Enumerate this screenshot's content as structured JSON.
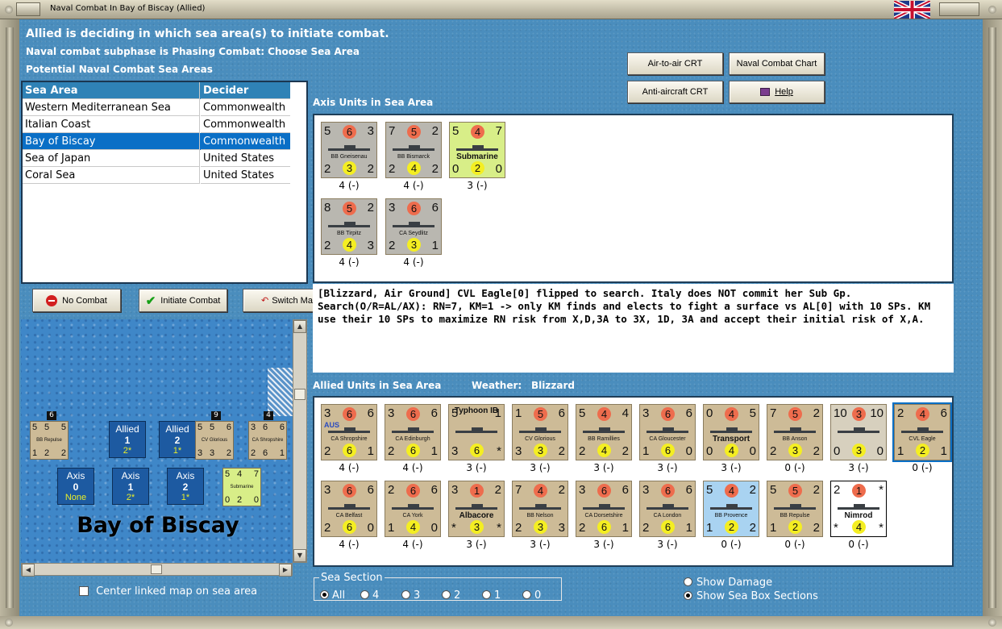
{
  "window": {
    "title": "Naval Combat In Bay of Biscay (Allied)",
    "flag_icon": "union-jack-icon"
  },
  "header": {
    "line1": "Allied is deciding in which sea area(s) to initiate combat.",
    "line2": "Naval combat subphase is Phasing Combat: Choose Sea Area",
    "line3": "Potential Naval Combat Sea Areas"
  },
  "buttons": {
    "air_to_air": "Air-to-air CRT",
    "naval_chart": "Naval Combat Chart",
    "anti_aircraft": "Anti-aircraft CRT",
    "help": "Help",
    "no_combat": "No Combat",
    "initiate": "Initiate Combat",
    "switch": "Switch Ma"
  },
  "sea_table": {
    "headers": [
      "Sea Area",
      "Decider"
    ],
    "rows": [
      [
        "Western Mediterranean Sea",
        "Commonwealth"
      ],
      [
        "Italian Coast",
        "Commonwealth"
      ],
      [
        "Bay of Biscay",
        "Commonwealth"
      ],
      [
        "Sea of Japan",
        "United States"
      ],
      [
        "Coral Sea",
        "United States"
      ]
    ],
    "selected_index": 2
  },
  "axis": {
    "title": "Axis Units in Sea Area",
    "units": [
      {
        "name": "BB Gneisenau",
        "tl": "5",
        "tc": "6",
        "tr": "3",
        "bl": "2",
        "bc": "3",
        "br": "2",
        "stat": "4 (-)",
        "color": "gray"
      },
      {
        "name": "BB Bismarck",
        "tl": "7",
        "tc": "5",
        "tr": "2",
        "bl": "2",
        "bc": "4",
        "br": "2",
        "stat": "4 (-)",
        "color": "gray"
      },
      {
        "name": "Submarine",
        "tl": "5",
        "tc": "4",
        "tr": "7",
        "bl": "0",
        "bc": "2",
        "br": "0",
        "stat": "3 (-)",
        "color": "green"
      },
      {
        "name": "BB Tirpitz",
        "tl": "8",
        "tc": "5",
        "tr": "2",
        "bl": "2",
        "bc": "4",
        "br": "3",
        "stat": "4 (-)",
        "color": "gray"
      },
      {
        "name": "CA Seydlitz",
        "tl": "3",
        "tc": "6",
        "tr": "6",
        "bl": "2",
        "bc": "3",
        "br": "1",
        "stat": "4 (-)",
        "color": "gray"
      }
    ]
  },
  "log_text": "[Blizzard, Air Ground]  CVL Eagle[0] flipped to search.  Italy does NOT commit her Sub Gp.  Search(O/R=AL/AX): RN=7, KM=1 -> only KM finds and elects to fight a surface vs AL[0] with 10 SPs.  KM use their 10 SPs to maximize RN risk from X,D,3A to 3X, 1D, 3A and accept their initial risk of X,A.",
  "allied": {
    "title": "Allied Units in Sea Area",
    "weather_label": "Weather:",
    "weather": "Blizzard",
    "units": [
      {
        "name": "CA Shropshire",
        "tl": "3",
        "tc": "6",
        "tr": "6",
        "bl": "2",
        "bc": "6",
        "br": "1",
        "stat": "4 (-)",
        "color": "tan",
        "flag": "AUS"
      },
      {
        "name": "CA Edinburgh",
        "tl": "3",
        "tc": "6",
        "tr": "6",
        "bl": "2",
        "bc": "6",
        "br": "1",
        "stat": "4 (-)",
        "color": "tan"
      },
      {
        "name": "Typhoon IB",
        "tl": "5",
        "tc": "",
        "tr": "1",
        "bl": "3",
        "bc": "6",
        "br": "*",
        "stat": "3 (-)",
        "color": "tan"
      },
      {
        "name": "CV Glorious",
        "tl": "1",
        "tc": "5",
        "tr": "6",
        "bl": "3",
        "bc": "3",
        "br": "2",
        "stat": "3 (-)",
        "color": "tan"
      },
      {
        "name": "BB Ramillies",
        "tl": "5",
        "tc": "4",
        "tr": "4",
        "bl": "2",
        "bc": "4",
        "br": "2",
        "stat": "3 (-)",
        "color": "tan"
      },
      {
        "name": "CA Gloucester",
        "tl": "3",
        "tc": "6",
        "tr": "6",
        "bl": "1",
        "bc": "6",
        "br": "0",
        "stat": "3 (-)",
        "color": "tan"
      },
      {
        "name": "Transport",
        "tl": "0",
        "tc": "4",
        "tr": "5",
        "bl": "0",
        "bc": "4",
        "br": "0",
        "stat": "3 (-)",
        "color": "tan"
      },
      {
        "name": "BB Anson",
        "tl": "7",
        "tc": "5",
        "tr": "2",
        "bl": "2",
        "bc": "3",
        "br": "2",
        "stat": "0 (-)",
        "color": "tan"
      },
      {
        "name": "",
        "tl": "10",
        "tc": "3",
        "tr": "10",
        "bl": "0",
        "bc": "3",
        "br": "0",
        "stat": "3 (-)",
        "color": "dark"
      },
      {
        "name": "CVL Eagle",
        "tl": "2",
        "tc": "4",
        "tr": "6",
        "bl": "1",
        "bc": "2",
        "br": "1",
        "stat": "0 (-)",
        "color": "tan",
        "selected": true
      },
      {
        "name": "CA Belfast",
        "tl": "3",
        "tc": "6",
        "tr": "6",
        "bl": "2",
        "bc": "6",
        "br": "0",
        "stat": "4 (-)",
        "color": "tan"
      },
      {
        "name": "CA York",
        "tl": "2",
        "tc": "6",
        "tr": "6",
        "bl": "1",
        "bc": "4",
        "br": "0",
        "stat": "4 (-)",
        "color": "tan"
      },
      {
        "name": "Albacore",
        "tl": "3",
        "tc": "1",
        "tr": "2",
        "bl": "*",
        "bc": "3",
        "br": "*",
        "stat": "3 (-)",
        "color": "tan"
      },
      {
        "name": "BB Nelson",
        "tl": "7",
        "tc": "4",
        "tr": "2",
        "bl": "2",
        "bc": "3",
        "br": "3",
        "stat": "3 (-)",
        "color": "tan"
      },
      {
        "name": "CA Dorsetshire",
        "tl": "3",
        "tc": "6",
        "tr": "6",
        "bl": "2",
        "bc": "6",
        "br": "1",
        "stat": "3 (-)",
        "color": "tan"
      },
      {
        "name": "CA London",
        "tl": "3",
        "tc": "6",
        "tr": "6",
        "bl": "2",
        "bc": "6",
        "br": "1",
        "stat": "3 (-)",
        "color": "tan"
      },
      {
        "name": "BB Provence",
        "tl": "5",
        "tc": "4",
        "tr": "2",
        "bl": "1",
        "bc": "2",
        "br": "2",
        "stat": "0 (-)",
        "color": "blue"
      },
      {
        "name": "BB Repulse",
        "tl": "5",
        "tc": "5",
        "tr": "2",
        "bl": "1",
        "bc": "2",
        "br": "2",
        "stat": "0 (-)",
        "color": "tan"
      },
      {
        "name": "Nimrod",
        "tl": "2",
        "tc": "1",
        "tr": "*",
        "bl": "*",
        "bc": "4",
        "br": "*",
        "stat": "0 (-)",
        "color": "white"
      }
    ]
  },
  "map": {
    "title": "Bay of Biscay",
    "allied_boxes": [
      {
        "a": "Allied",
        "b": "1",
        "c": "2*"
      },
      {
        "a": "Allied",
        "b": "2",
        "c": "1*"
      }
    ],
    "axis_boxes": [
      {
        "a": "Axis",
        "b": "0",
        "c": "None"
      },
      {
        "a": "Axis",
        "b": "1",
        "c": "2*"
      },
      {
        "a": "Axis",
        "b": "2",
        "c": "1*"
      }
    ],
    "stack_counts": [
      "6",
      "9",
      "4"
    ],
    "counters": [
      {
        "name": "BB Repulse",
        "tl": "5",
        "tc": "5",
        "tr": "5",
        "bl": "1",
        "bc": "2",
        "br": "2"
      },
      {
        "name": "CV Glorious",
        "tl": "5",
        "tc": "5",
        "tr": "6",
        "bl": "3",
        "bc": "3",
        "br": "2"
      },
      {
        "name": "CA Shropshire",
        "tl": "3",
        "tc": "6",
        "tr": "6",
        "bl": "2",
        "bc": "6",
        "br": "1"
      },
      {
        "name": "Submarine",
        "tl": "5",
        "tc": "4",
        "tr": "7",
        "bl": "0",
        "bc": "2",
        "br": "0"
      }
    ]
  },
  "center_checkbox": "Center linked map on sea area",
  "sea_section": {
    "title": "Sea Section",
    "options": [
      "All",
      "4",
      "3",
      "2",
      "1",
      "0"
    ],
    "selected": "All"
  },
  "show_options": {
    "damage": "Show Damage",
    "sections": "Show Sea Box Sections",
    "selected": "sections"
  },
  "colors": {
    "background": "#4a8dbd",
    "selection": "#0a6fc6",
    "header_row": "#2f82b6"
  }
}
